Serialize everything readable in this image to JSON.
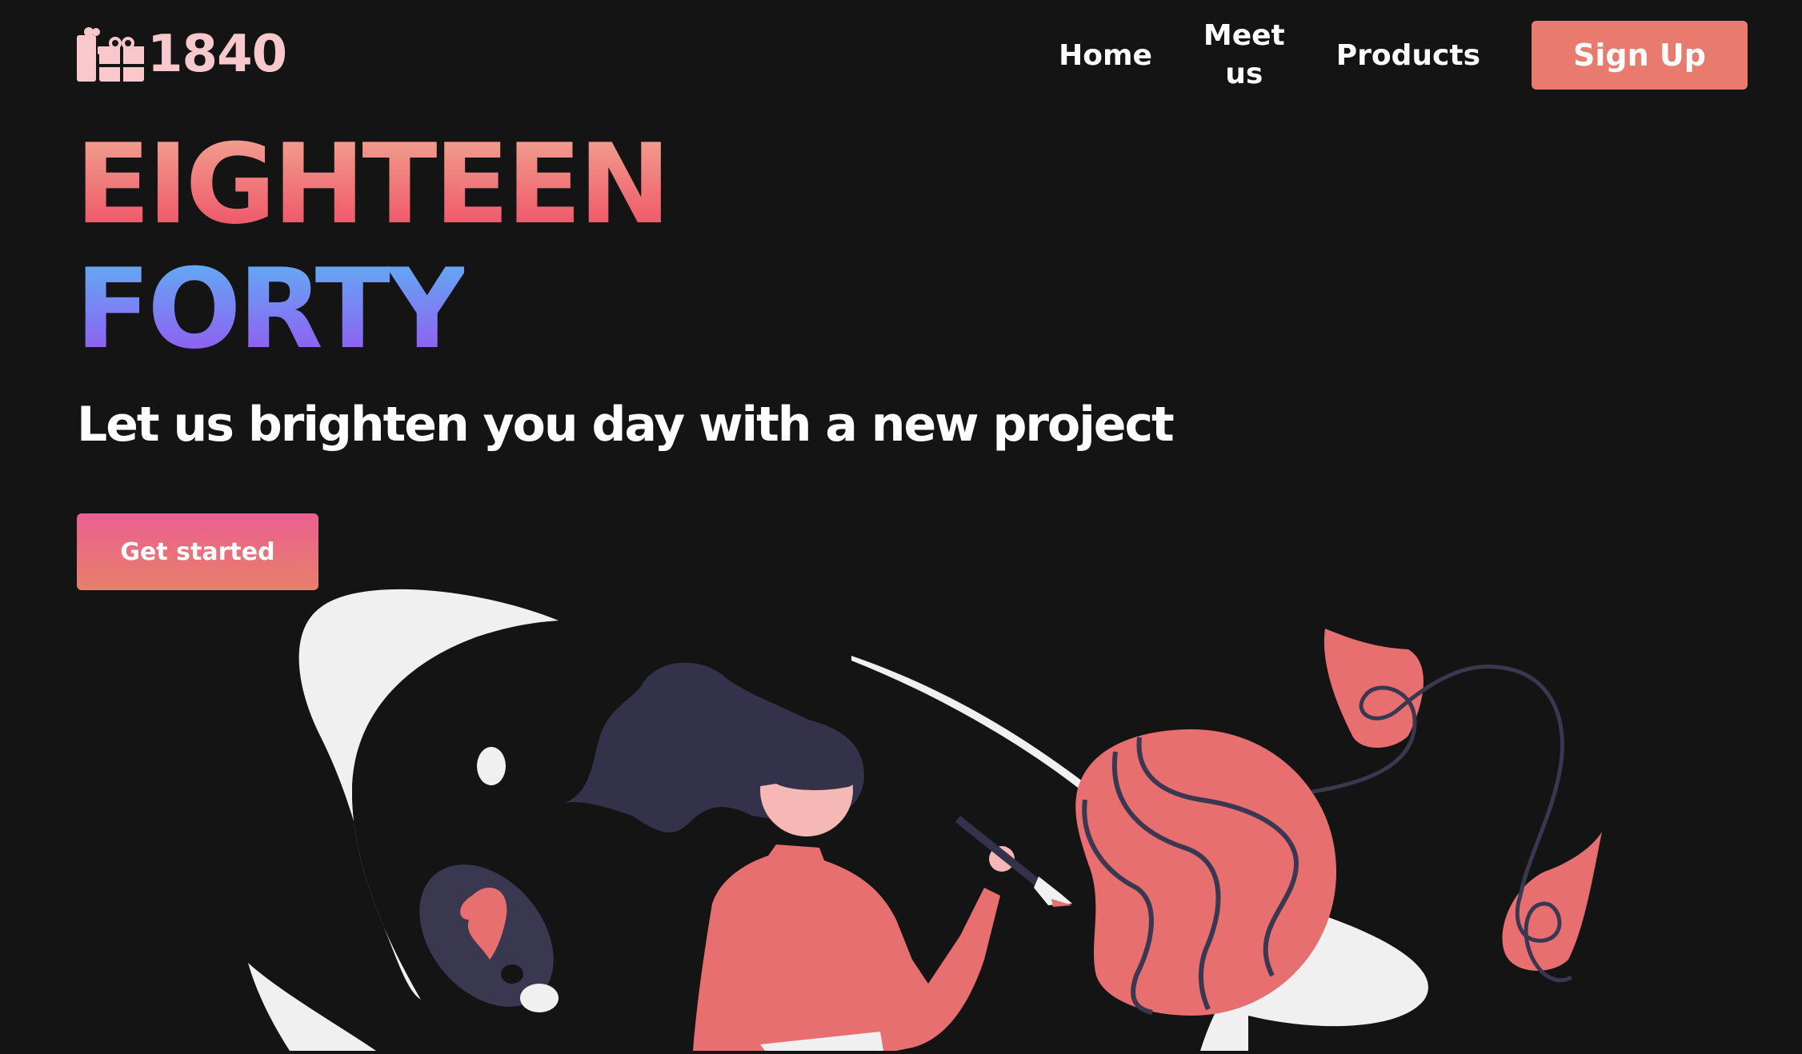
{
  "brand": {
    "logo_text": "1840",
    "icon": "gift-icon"
  },
  "nav": {
    "items": [
      {
        "label": "Home"
      },
      {
        "label_line1": "Meet",
        "label_line2": "us"
      },
      {
        "label": "Products"
      }
    ],
    "signup_label": "Sign Up"
  },
  "hero": {
    "line1": "EIGHTEEN",
    "line2": "FORTY",
    "tagline": "Let us brighten you day with a new project",
    "cta_label": "Get started"
  },
  "illustration": {
    "name": "woman-painting-illustration"
  },
  "colors": {
    "background": "#141414",
    "accent_coral": "#e97b6e",
    "logo_pink": "#f8c8cc",
    "gradient_warm_top": "#f2a491",
    "gradient_warm_bottom": "#ee4d63",
    "gradient_cool_top": "#5fb0f3",
    "gradient_cool_bottom": "#9654f3",
    "cta_top": "#ea5f91",
    "cta_bottom": "#e8806a",
    "figure_dark": "#34324a",
    "figure_skin": "#f5b8b4",
    "figure_red": "#e86f70",
    "shape_light": "#f0f0f0"
  }
}
